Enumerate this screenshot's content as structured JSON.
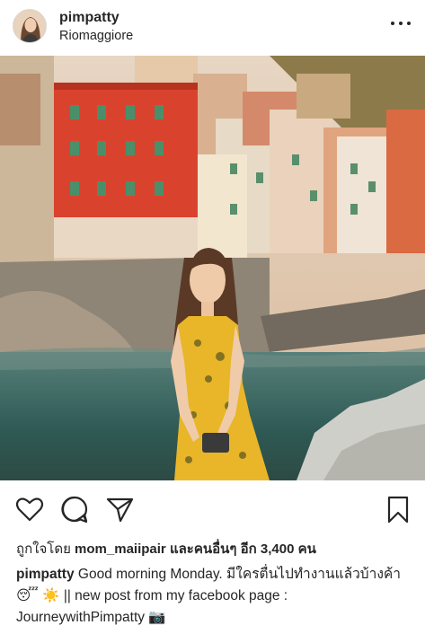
{
  "post": {
    "username": "pimpatty",
    "location": "Riomaggiore"
  },
  "icons": {
    "avatar": "profile-avatar",
    "more": "more-options-icon",
    "like": "heart-icon",
    "comment": "comment-bubble-icon",
    "share": "paper-plane-icon",
    "save": "bookmark-icon"
  },
  "likes": {
    "prefix": "ถูกใจโดย",
    "user": "mom_maiipair",
    "middle": "และคนอื่นๆ อีก",
    "count": "3,400",
    "suffix": "คน"
  },
  "caption": {
    "username": "pimpatty",
    "text_part1": "Good morning Monday.  มีใครตื่นไปทำงานแล้วบ้างค้า",
    "emoji1": "😴",
    "emoji2": "☀️",
    "text_part2": "|| new post from my facebook page : JourneywithPimpatty",
    "emoji3": "📷"
  },
  "colors": {
    "text": "#262626",
    "dress": "#e8b628",
    "red_building": "#d9432e",
    "water": "#3f6f6a"
  }
}
